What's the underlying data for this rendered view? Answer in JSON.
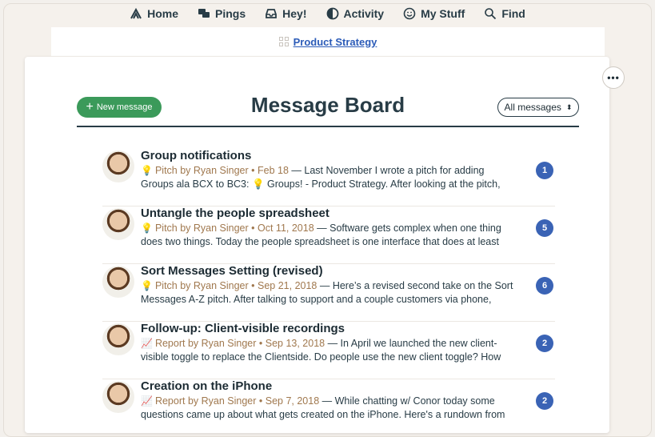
{
  "nav": {
    "items": [
      {
        "label": "Home",
        "icon": "home-icon"
      },
      {
        "label": "Pings",
        "icon": "pings-icon"
      },
      {
        "label": "Hey!",
        "icon": "hey-icon"
      },
      {
        "label": "Activity",
        "icon": "activity-icon"
      },
      {
        "label": "My Stuff",
        "icon": "mystuff-icon"
      },
      {
        "label": "Find",
        "icon": "search-icon"
      }
    ]
  },
  "project": {
    "name": "Product Strategy"
  },
  "board": {
    "title": "Message Board",
    "new_message_label": "New message",
    "filter_label": "All messages"
  },
  "messages": [
    {
      "title": "Group notifications",
      "icon": "💡",
      "meta": "Pitch by Ryan Singer • Feb 18",
      "line1_rest": " — Last November I wrote a pitch for adding",
      "line2": "Groups ala BCX to BC3: 💡 Groups! - Product Strategy. After looking at the pitch,",
      "count": "1"
    },
    {
      "title": "Untangle the people spreadsheet",
      "icon": "💡",
      "meta": "Pitch by Ryan Singer • Oct 11, 2018",
      "line1_rest": " — Software gets complex when one thing",
      "line2": "does two things. Today the people spreadsheet is one interface that does at least",
      "count": "5"
    },
    {
      "title": "Sort Messages Setting (revised)",
      "icon": "💡",
      "meta": "Pitch by Ryan Singer • Sep 21, 2018",
      "line1_rest": " — Here’s a revised second take on the Sort",
      "line2": "Messages A-Z pitch. After talking to support and a couple customers via phone,",
      "count": "6"
    },
    {
      "title": "Follow-up: Client-visible recordings",
      "icon": "📈",
      "meta": "Report by Ryan Singer • Sep 13, 2018",
      "line1_rest": " — In April we launched the new client-",
      "line2": "visible toggle to replace the Clientside. Do people use the new client toggle? How",
      "count": "2"
    },
    {
      "title": "Creation on the iPhone",
      "icon": "📈",
      "meta": "Report by Ryan Singer • Sep 7, 2018",
      "line1_rest": " — While chatting w/ Conor today some",
      "line2": "questions came up about what gets created on the iPhone. Here's a rundown from",
      "count": "2"
    }
  ]
}
